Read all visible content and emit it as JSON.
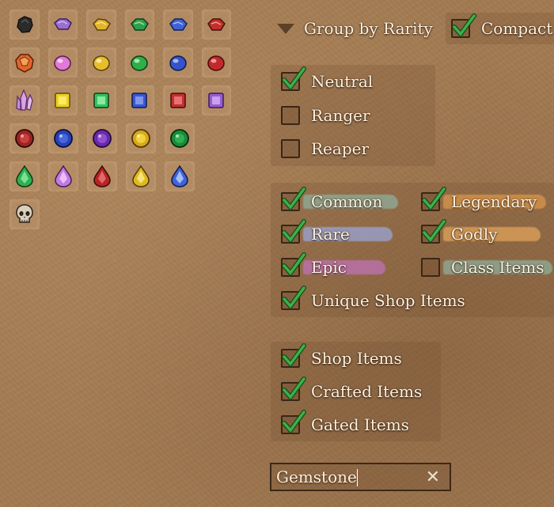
{
  "grid": {
    "rows": [
      [
        "rough-black-gem-icon",
        "rough-purple-gem-icon",
        "rough-yellow-gem-icon",
        "rough-green-gem-icon",
        "rough-blue-gem-icon",
        "rough-red-gem-icon"
      ],
      [
        "orange-gem-icon",
        "pink-gem-icon",
        "yellow-gem-icon",
        "green-gem-icon",
        "blue-gem-icon",
        "red-gem-icon"
      ],
      [
        "purple-crystal-icon",
        "square-yellow-gem-icon",
        "square-green-gem-icon",
        "square-blue-gem-icon",
        "square-red-gem-icon",
        "square-purple-gem-icon"
      ],
      [
        "round-red-gem-icon",
        "round-blue-gem-icon",
        "round-purple-gem-icon",
        "round-yellow-gem-icon",
        "round-green-gem-icon"
      ],
      [
        "teardrop-green-gem-icon",
        "teardrop-pink-gem-icon",
        "teardrop-red-gem-icon",
        "teardrop-yellow-gem-icon",
        "teardrop-blue-gem-icon"
      ],
      [
        "skull-icon"
      ]
    ]
  },
  "header": {
    "group_label": "Group by Rarity",
    "compact_label": "Compact",
    "compact_checked": true
  },
  "classes": [
    {
      "label": "Neutral",
      "checked": true
    },
    {
      "label": "Ranger",
      "checked": false
    },
    {
      "label": "Reaper",
      "checked": false
    }
  ],
  "rarities": [
    {
      "label": "Common",
      "checked": true,
      "color": "#8fae9b"
    },
    {
      "label": "Legendary",
      "checked": true,
      "color": "#d9974a"
    },
    {
      "label": "Rare",
      "checked": true,
      "color": "#9aa6d6"
    },
    {
      "label": "Godly",
      "checked": true,
      "color": "#e0a35a"
    },
    {
      "label": "Epic",
      "checked": true,
      "color": "#c072b6"
    },
    {
      "label": "Class Items",
      "checked": false,
      "color": "#8fae9b"
    },
    {
      "label": "Unique Shop Items",
      "checked": true,
      "color": ""
    }
  ],
  "sources": [
    {
      "label": "Shop Items",
      "checked": true
    },
    {
      "label": "Crafted Items",
      "checked": true
    },
    {
      "label": "Gated Items",
      "checked": true
    }
  ],
  "search": {
    "value": "Gemstone"
  },
  "colors": {
    "check": "#2f9a3d",
    "text": "#fbf2e2",
    "box": "#3a2614"
  }
}
